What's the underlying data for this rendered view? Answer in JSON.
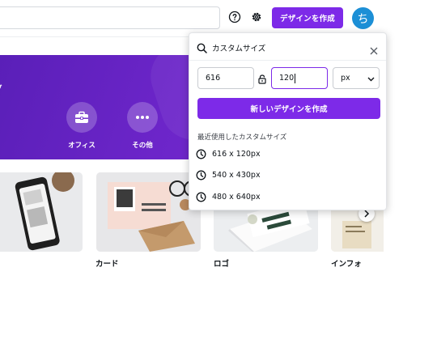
{
  "topbar": {
    "create_button_label": "デザインを作成",
    "avatar_initial": "ち"
  },
  "hero": {
    "cut_label": "グ",
    "items": [
      {
        "label": "オフィス",
        "icon": "briefcase-icon"
      },
      {
        "label": "その他",
        "icon": "more-icon"
      }
    ]
  },
  "cards": [
    {
      "label": ""
    },
    {
      "label": "カード"
    },
    {
      "label": "ロゴ"
    },
    {
      "label": "インフォ"
    }
  ],
  "custom_size": {
    "title": "カスタムサイズ",
    "width_value": "616",
    "height_value": "120",
    "unit": "px",
    "create_button_label": "新しいデザインを作成",
    "recent_heading": "最近使用したカスタムサイズ",
    "recent_sizes": [
      "616 x 120px",
      "540 x 430px",
      "480 x 640px"
    ]
  },
  "colors": {
    "accent": "#7d2ae8",
    "hero_bg": "#6c25c9",
    "avatar_bg": "#1c8fd6"
  }
}
